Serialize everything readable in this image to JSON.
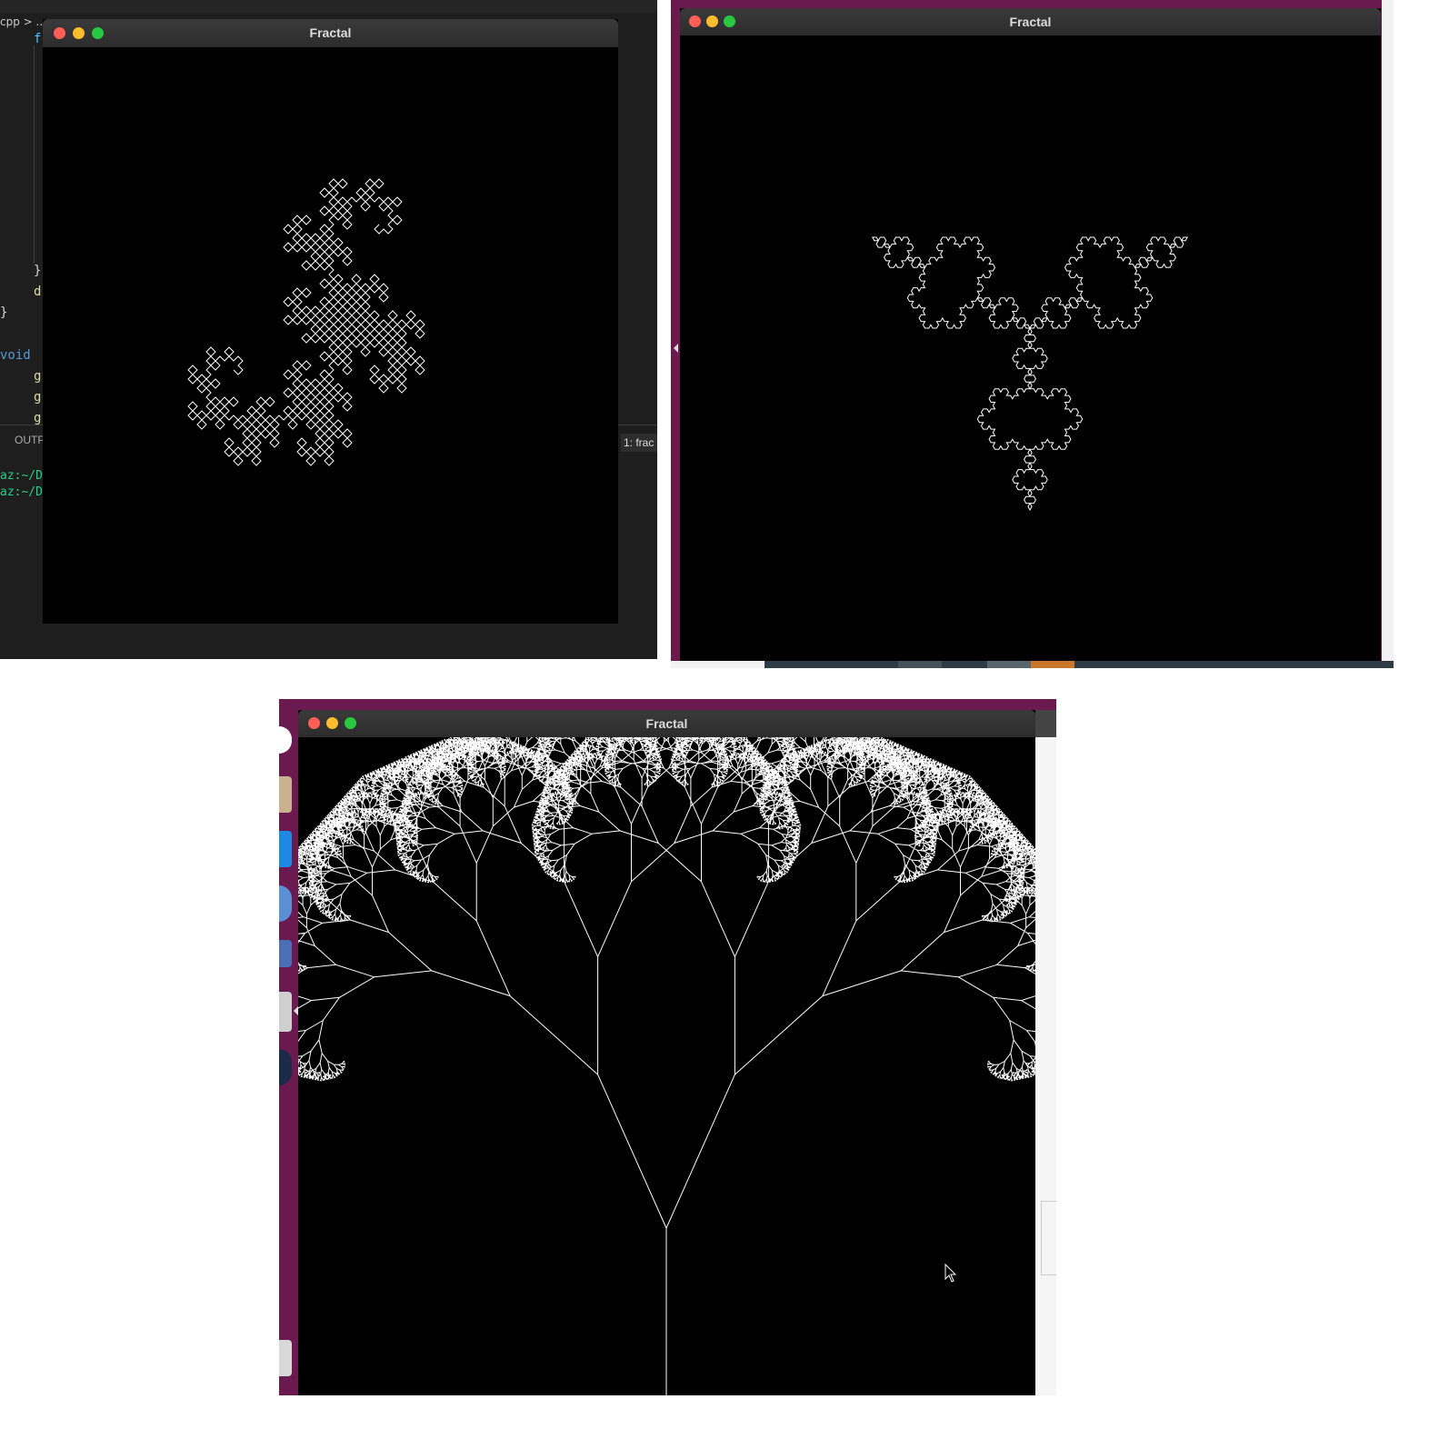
{
  "editor": {
    "breadcrumb": "cpp > ..",
    "code_fragments": [
      "f",
      "}",
      "d",
      "}",
      "void",
      "g",
      "g",
      "g"
    ],
    "output_tab": "OUTP",
    "terminal_lines": [
      "az:~/De",
      "az:~/De"
    ],
    "terminal_tab": "1: frac"
  },
  "windows": [
    {
      "title": "Fractal",
      "fractal": "dragon-curve"
    },
    {
      "title": "Fractal",
      "fractal": "koch-snowflake"
    },
    {
      "title": "Fractal",
      "fractal": "fractal-tree"
    }
  ],
  "colors": {
    "close": "#ff5f57",
    "minimize": "#febc2e",
    "maximize": "#28c840",
    "desktop": "#6b1a4f",
    "fractal_stroke": "#ffffff"
  }
}
